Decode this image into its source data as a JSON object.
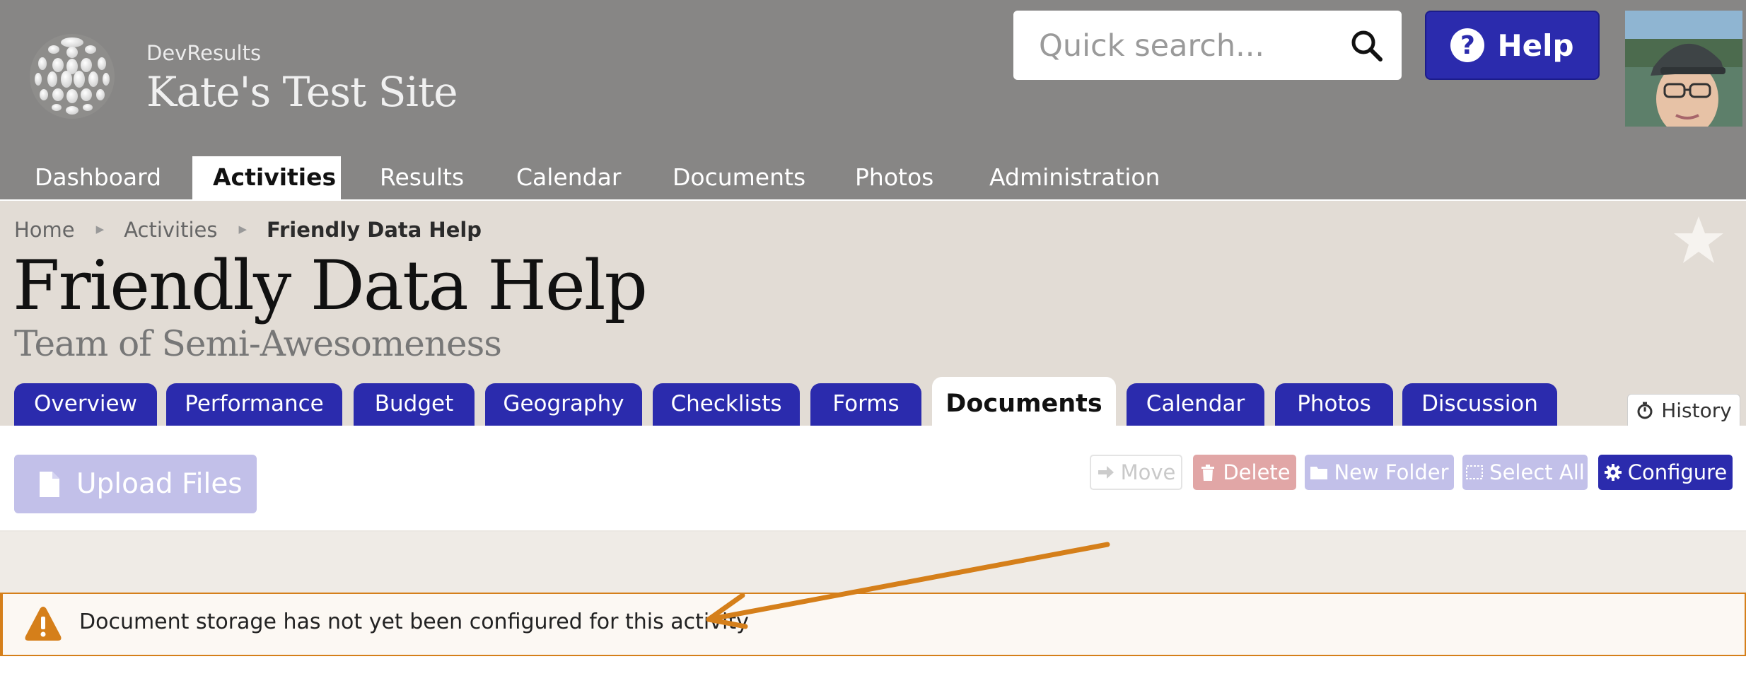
{
  "header": {
    "org": "DevResults",
    "site_name": "Kate's Test Site",
    "search_placeholder": "Quick search...",
    "help_label": "Help",
    "help_icon_glyph": "?"
  },
  "main_nav": {
    "items": [
      {
        "label": "Dashboard"
      },
      {
        "label": "Activities"
      },
      {
        "label": "Results"
      },
      {
        "label": "Calendar"
      },
      {
        "label": "Documents"
      },
      {
        "label": "Photos"
      },
      {
        "label": "Administration"
      }
    ],
    "active": "Activities"
  },
  "breadcrumb": [
    "Home",
    "Activities",
    "Friendly Data Help"
  ],
  "page": {
    "title": "Friendly Data Help",
    "subtitle": "Team of Semi-Awesomeness"
  },
  "tabs": {
    "items": [
      {
        "label": "Overview"
      },
      {
        "label": "Performance"
      },
      {
        "label": "Budget"
      },
      {
        "label": "Geography"
      },
      {
        "label": "Checklists"
      },
      {
        "label": "Forms"
      },
      {
        "label": "Documents"
      },
      {
        "label": "Calendar"
      },
      {
        "label": "Photos"
      },
      {
        "label": "Discussion"
      }
    ],
    "active": "Documents",
    "history_label": "History"
  },
  "toolbar": {
    "upload": "Upload Files",
    "move": "Move",
    "delete": "Delete",
    "new_folder": "New Folder",
    "select_all": "Select All",
    "configure": "Configure"
  },
  "alert": {
    "message": "Document storage has not yet been configured for this activity"
  },
  "colors": {
    "header_bg": "#878685",
    "brand_blue": "#2b2bad",
    "hero_bg": "#e2dcd5",
    "warning_orange": "#d57f1a",
    "disabled_blue": "#c2c0e9",
    "disabled_red": "#e1a6a6"
  },
  "icons": {
    "logo": "globe-logo-icon",
    "search": "search-icon",
    "favorite": "star-icon",
    "history": "stopwatch-icon",
    "upload": "file-icon",
    "move": "arrow-right-icon",
    "delete": "trash-icon",
    "new_folder": "folder-icon",
    "select_all": "dashed-square-icon",
    "configure": "gear-icon",
    "alert": "warning-triangle-icon",
    "annotation": "orange-arrow-icon"
  }
}
